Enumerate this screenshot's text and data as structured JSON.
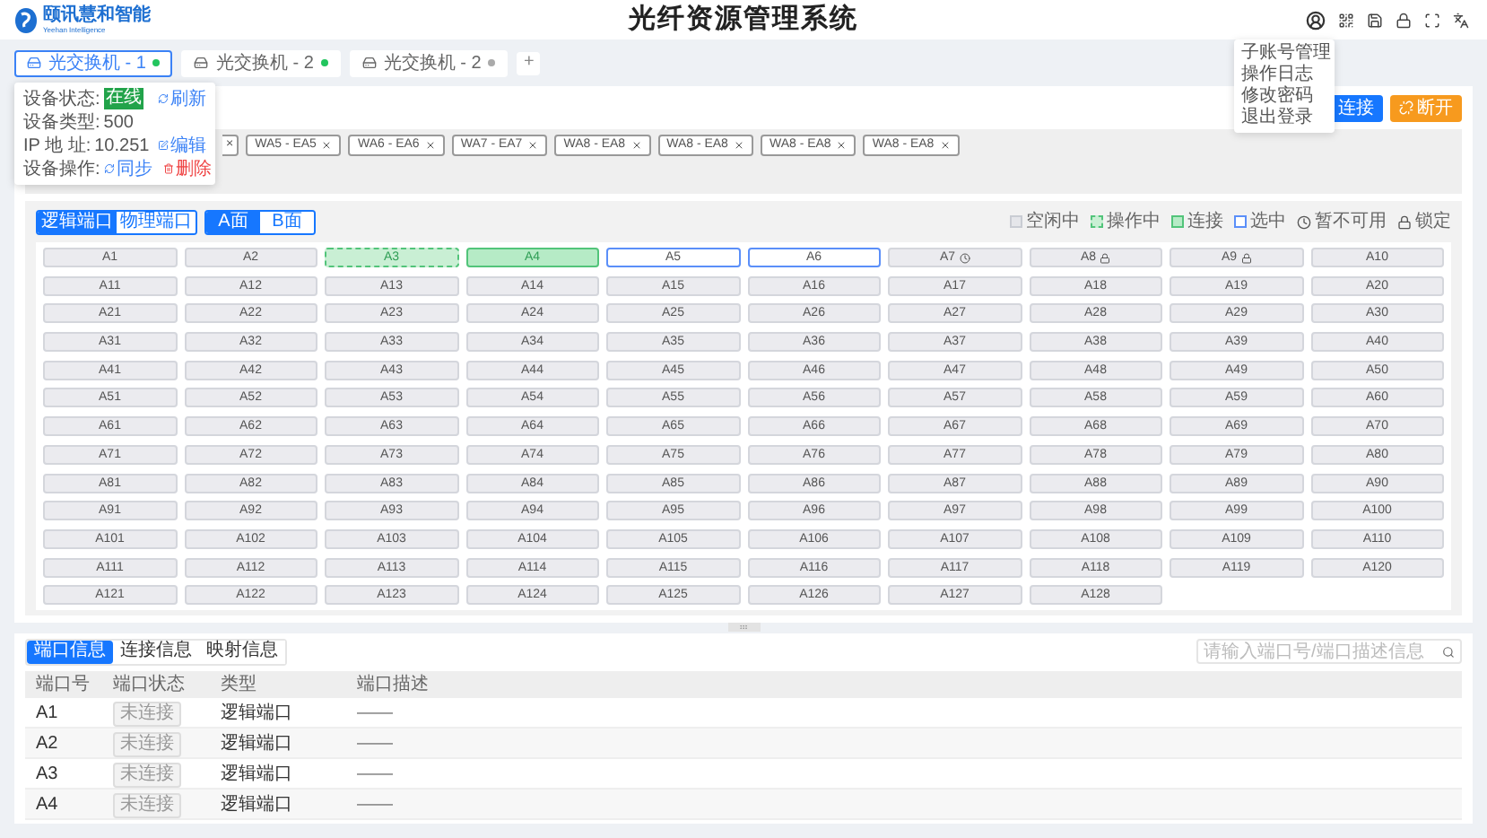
{
  "header": {
    "logo_text": "颐讯慧和智能",
    "logo_subtext": "Yeehan Intelligence",
    "title": "光纤资源管理系统"
  },
  "device_tabs": [
    {
      "label": "光交换机 - 1",
      "selected": true,
      "online": true
    },
    {
      "label": "光交换机 - 2",
      "selected": false,
      "online": true
    },
    {
      "label": "光交换机 - 2",
      "selected": false,
      "online": false
    }
  ],
  "add_tab": "+",
  "device_popover": {
    "status_label": "设备状态:",
    "status": "在线",
    "refresh": "刷新",
    "type_label": "设备类型:",
    "type": "500",
    "ip_label": "IP 地 址:",
    "ip": "10.251",
    "edit": "编辑",
    "ops_label": "设备操作:",
    "sync": "同步",
    "delete": "删除"
  },
  "user_menu": [
    "子账号管理",
    "操作日志",
    "修改密码",
    "退出登录"
  ],
  "actions": {
    "connect": "连接",
    "disconnect": "断开"
  },
  "connection_tags": [
    {
      "label": "×",
      "kind": "cut"
    },
    {
      "label": "WA5 - EA5",
      "kind": "full"
    },
    {
      "label": "WA6 - EA6",
      "kind": "full"
    },
    {
      "label": "WA7 - EA7",
      "kind": "full"
    },
    {
      "label": "WA8 - EA8",
      "kind": "full"
    },
    {
      "label": "WA8 - EA8",
      "kind": "full"
    },
    {
      "label": "WA8 - EA8",
      "kind": "full"
    },
    {
      "label": "WA8 - EA8",
      "kind": "full"
    }
  ],
  "port_type_toggle": [
    {
      "label": "逻辑端口",
      "selected": true
    },
    {
      "label": "物理端口",
      "selected": false
    }
  ],
  "side_toggle": [
    {
      "label": "A面",
      "selected": true
    },
    {
      "label": "B面",
      "selected": false
    }
  ],
  "legend": [
    {
      "label": "空闲中",
      "kind": "idle"
    },
    {
      "label": "操作中",
      "kind": "operating"
    },
    {
      "label": "连接",
      "kind": "connected"
    },
    {
      "label": "选中",
      "kind": "selected"
    },
    {
      "label": "暂不可用",
      "kind": "unavailable"
    },
    {
      "label": "锁定",
      "kind": "locked"
    }
  ],
  "ports": [
    {
      "label": "A1",
      "kind": "idle"
    },
    {
      "label": "A2",
      "kind": "idle"
    },
    {
      "label": "A3",
      "kind": "operating"
    },
    {
      "label": "A4",
      "kind": "connected"
    },
    {
      "label": "A5",
      "kind": "selected"
    },
    {
      "label": "A6",
      "kind": "selected"
    },
    {
      "label": "A7",
      "kind": "unavailable"
    },
    {
      "label": "A8",
      "kind": "locked"
    },
    {
      "label": "A9",
      "kind": "locked"
    },
    {
      "label": "A10",
      "kind": "idle"
    },
    {
      "label": "A11",
      "kind": "idle"
    },
    {
      "label": "A12",
      "kind": "idle"
    },
    {
      "label": "A13",
      "kind": "idle"
    },
    {
      "label": "A14",
      "kind": "idle"
    },
    {
      "label": "A15",
      "kind": "idle"
    },
    {
      "label": "A16",
      "kind": "idle"
    },
    {
      "label": "A17",
      "kind": "idle"
    },
    {
      "label": "A18",
      "kind": "idle"
    },
    {
      "label": "A19",
      "kind": "idle"
    },
    {
      "label": "A20",
      "kind": "idle"
    },
    {
      "label": "A21",
      "kind": "idle"
    },
    {
      "label": "A22",
      "kind": "idle"
    },
    {
      "label": "A23",
      "kind": "idle"
    },
    {
      "label": "A24",
      "kind": "idle"
    },
    {
      "label": "A25",
      "kind": "idle"
    },
    {
      "label": "A26",
      "kind": "idle"
    },
    {
      "label": "A27",
      "kind": "idle"
    },
    {
      "label": "A28",
      "kind": "idle"
    },
    {
      "label": "A29",
      "kind": "idle"
    },
    {
      "label": "A30",
      "kind": "idle"
    },
    {
      "label": "A31",
      "kind": "idle"
    },
    {
      "label": "A32",
      "kind": "idle"
    },
    {
      "label": "A33",
      "kind": "idle"
    },
    {
      "label": "A34",
      "kind": "idle"
    },
    {
      "label": "A35",
      "kind": "idle"
    },
    {
      "label": "A36",
      "kind": "idle"
    },
    {
      "label": "A37",
      "kind": "idle"
    },
    {
      "label": "A38",
      "kind": "idle"
    },
    {
      "label": "A39",
      "kind": "idle"
    },
    {
      "label": "A40",
      "kind": "idle"
    },
    {
      "label": "A41",
      "kind": "idle"
    },
    {
      "label": "A42",
      "kind": "idle"
    },
    {
      "label": "A43",
      "kind": "idle"
    },
    {
      "label": "A44",
      "kind": "idle"
    },
    {
      "label": "A45",
      "kind": "idle"
    },
    {
      "label": "A46",
      "kind": "idle"
    },
    {
      "label": "A47",
      "kind": "idle"
    },
    {
      "label": "A48",
      "kind": "idle"
    },
    {
      "label": "A49",
      "kind": "idle"
    },
    {
      "label": "A50",
      "kind": "idle"
    },
    {
      "label": "A51",
      "kind": "idle"
    },
    {
      "label": "A52",
      "kind": "idle"
    },
    {
      "label": "A53",
      "kind": "idle"
    },
    {
      "label": "A54",
      "kind": "idle"
    },
    {
      "label": "A55",
      "kind": "idle"
    },
    {
      "label": "A56",
      "kind": "idle"
    },
    {
      "label": "A57",
      "kind": "idle"
    },
    {
      "label": "A58",
      "kind": "idle"
    },
    {
      "label": "A59",
      "kind": "idle"
    },
    {
      "label": "A60",
      "kind": "idle"
    },
    {
      "label": "A61",
      "kind": "idle"
    },
    {
      "label": "A62",
      "kind": "idle"
    },
    {
      "label": "A63",
      "kind": "idle"
    },
    {
      "label": "A64",
      "kind": "idle"
    },
    {
      "label": "A65",
      "kind": "idle"
    },
    {
      "label": "A66",
      "kind": "idle"
    },
    {
      "label": "A67",
      "kind": "idle"
    },
    {
      "label": "A68",
      "kind": "idle"
    },
    {
      "label": "A69",
      "kind": "idle"
    },
    {
      "label": "A70",
      "kind": "idle"
    },
    {
      "label": "A71",
      "kind": "idle"
    },
    {
      "label": "A72",
      "kind": "idle"
    },
    {
      "label": "A73",
      "kind": "idle"
    },
    {
      "label": "A74",
      "kind": "idle"
    },
    {
      "label": "A75",
      "kind": "idle"
    },
    {
      "label": "A76",
      "kind": "idle"
    },
    {
      "label": "A77",
      "kind": "idle"
    },
    {
      "label": "A78",
      "kind": "idle"
    },
    {
      "label": "A79",
      "kind": "idle"
    },
    {
      "label": "A80",
      "kind": "idle"
    },
    {
      "label": "A81",
      "kind": "idle"
    },
    {
      "label": "A82",
      "kind": "idle"
    },
    {
      "label": "A83",
      "kind": "idle"
    },
    {
      "label": "A84",
      "kind": "idle"
    },
    {
      "label": "A85",
      "kind": "idle"
    },
    {
      "label": "A86",
      "kind": "idle"
    },
    {
      "label": "A87",
      "kind": "idle"
    },
    {
      "label": "A88",
      "kind": "idle"
    },
    {
      "label": "A89",
      "kind": "idle"
    },
    {
      "label": "A90",
      "kind": "idle"
    },
    {
      "label": "A91",
      "kind": "idle"
    },
    {
      "label": "A92",
      "kind": "idle"
    },
    {
      "label": "A93",
      "kind": "idle"
    },
    {
      "label": "A94",
      "kind": "idle"
    },
    {
      "label": "A95",
      "kind": "idle"
    },
    {
      "label": "A96",
      "kind": "idle"
    },
    {
      "label": "A97",
      "kind": "idle"
    },
    {
      "label": "A98",
      "kind": "idle"
    },
    {
      "label": "A99",
      "kind": "idle"
    },
    {
      "label": "A100",
      "kind": "idle"
    },
    {
      "label": "A101",
      "kind": "idle"
    },
    {
      "label": "A102",
      "kind": "idle"
    },
    {
      "label": "A103",
      "kind": "idle"
    },
    {
      "label": "A104",
      "kind": "idle"
    },
    {
      "label": "A105",
      "kind": "idle"
    },
    {
      "label": "A106",
      "kind": "idle"
    },
    {
      "label": "A107",
      "kind": "idle"
    },
    {
      "label": "A108",
      "kind": "idle"
    },
    {
      "label": "A109",
      "kind": "idle"
    },
    {
      "label": "A110",
      "kind": "idle"
    },
    {
      "label": "A111",
      "kind": "idle"
    },
    {
      "label": "A112",
      "kind": "idle"
    },
    {
      "label": "A113",
      "kind": "idle"
    },
    {
      "label": "A114",
      "kind": "idle"
    },
    {
      "label": "A115",
      "kind": "idle"
    },
    {
      "label": "A116",
      "kind": "idle"
    },
    {
      "label": "A117",
      "kind": "idle"
    },
    {
      "label": "A118",
      "kind": "idle"
    },
    {
      "label": "A119",
      "kind": "idle"
    },
    {
      "label": "A120",
      "kind": "idle"
    },
    {
      "label": "A121",
      "kind": "idle"
    },
    {
      "label": "A122",
      "kind": "idle"
    },
    {
      "label": "A123",
      "kind": "idle"
    },
    {
      "label": "A124",
      "kind": "idle"
    },
    {
      "label": "A125",
      "kind": "idle"
    },
    {
      "label": "A126",
      "kind": "idle"
    },
    {
      "label": "A127",
      "kind": "idle"
    },
    {
      "label": "A128",
      "kind": "idle"
    }
  ],
  "info_tabs": [
    {
      "label": "端口信息",
      "selected": true
    },
    {
      "label": "连接信息",
      "selected": false
    },
    {
      "label": "映射信息",
      "selected": false
    }
  ],
  "search": {
    "placeholder": "请输入端口号/端口描述信息"
  },
  "table": {
    "columns": [
      "端口号",
      "端口状态",
      "类型",
      "端口描述"
    ],
    "rows": [
      {
        "port": "A1",
        "status": "未连接",
        "type": "逻辑端口",
        "description": "——"
      },
      {
        "port": "A2",
        "status": "未连接",
        "type": "逻辑端口",
        "description": "——"
      },
      {
        "port": "A3",
        "status": "未连接",
        "type": "逻辑端口",
        "description": "——"
      },
      {
        "port": "A4",
        "status": "未连接",
        "type": "逻辑端口",
        "description": "——"
      }
    ]
  }
}
